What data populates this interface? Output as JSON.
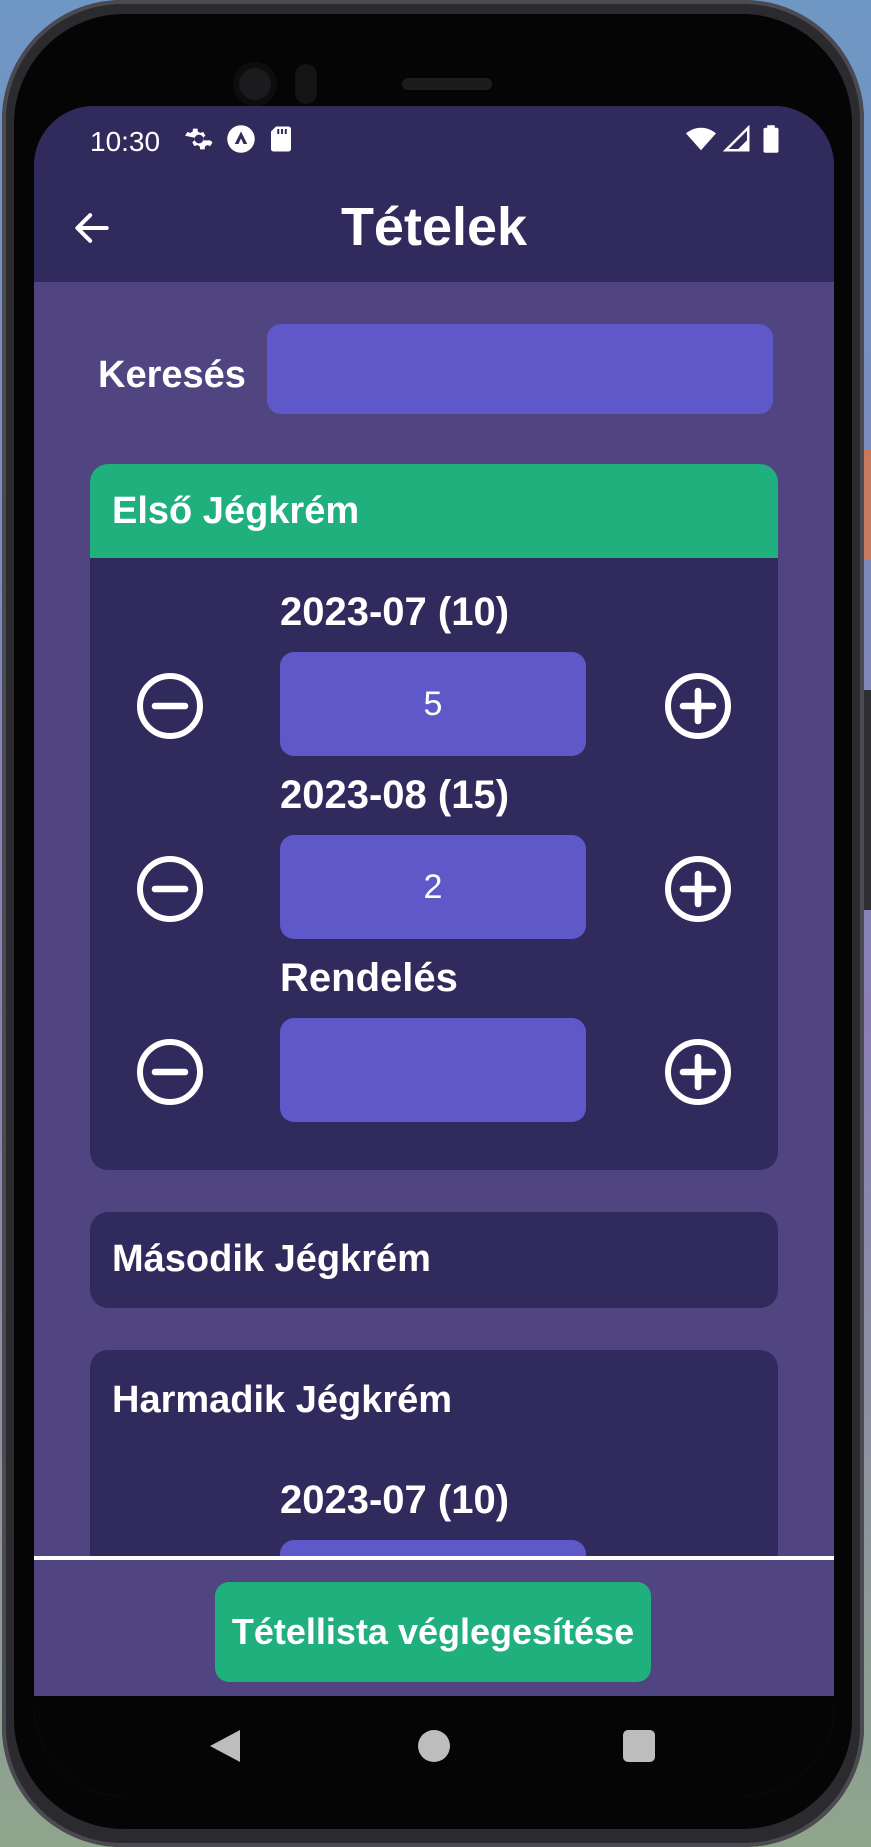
{
  "status_bar": {
    "time": "10:30",
    "left_icons": [
      "settings-icon",
      "app-icon",
      "sd-card-icon"
    ],
    "right_icons": [
      "wifi-icon",
      "signal-icon",
      "battery-icon"
    ]
  },
  "app_bar": {
    "title": "Tételek",
    "back_icon": "arrow-left-icon"
  },
  "search": {
    "label": "Keresés",
    "value": "",
    "placeholder": ""
  },
  "items": [
    {
      "name": "Első Jégkrém",
      "expanded": true,
      "rows": [
        {
          "label": "2023-07 (10)",
          "value": "5"
        },
        {
          "label": "2023-08 (15)",
          "value": "2"
        },
        {
          "label": "Rendelés",
          "value": ""
        }
      ]
    },
    {
      "name": "Második Jégkrém",
      "expanded": false,
      "rows": []
    },
    {
      "name": "Harmadik Jégkrém",
      "expanded": true,
      "rows": [
        {
          "label": "2023-07 (10)",
          "value": ""
        }
      ]
    }
  ],
  "footer": {
    "finalize_label": "Tétellista véglegesítése"
  },
  "colors": {
    "background": "#504580",
    "bar": "#312a5c",
    "input": "#5e58c9",
    "accent": "#20b07e",
    "text": "#ffffff"
  },
  "nav": {
    "icons": [
      "back-triangle-icon",
      "home-circle-icon",
      "recents-square-icon"
    ]
  }
}
